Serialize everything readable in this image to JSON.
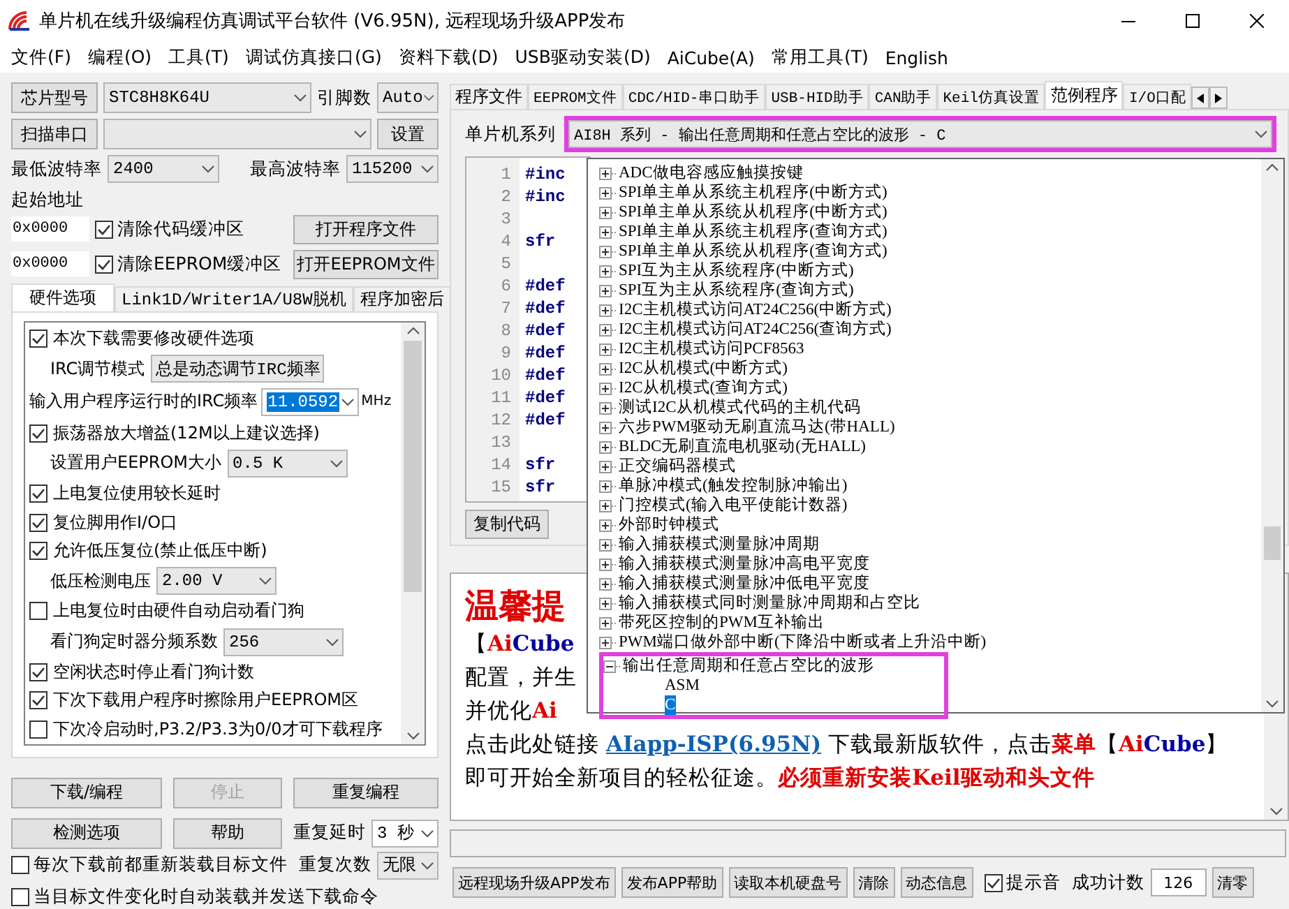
{
  "window": {
    "title": "单片机在线升级编程仿真调试平台软件 (V6.95N), 远程现场升级APP发布"
  },
  "menu": [
    "文件(F)",
    "编程(O)",
    "工具(T)",
    "调试仿真接口(G)",
    "资料下载(D)",
    "USB驱动安装(D)",
    "AiCube(A)",
    "常用工具(T)",
    "English"
  ],
  "left": {
    "chip": {
      "button": "芯片型号",
      "value": "STC8H8K64U",
      "pins_label": "引脚数",
      "pins": "Auto"
    },
    "port": {
      "button": "扫描串口",
      "settings": "设置"
    },
    "baud": {
      "min_label": "最低波特率",
      "min": "2400",
      "max_label": "最高波特率",
      "max": "115200"
    },
    "start_address_label": "起始地址",
    "buffers": [
      {
        "address": "0x0000",
        "label": "清除代码缓冲区",
        "checked": true,
        "button": "打开程序文件"
      },
      {
        "address": "0x0000",
        "label": "清除EEPROM缓冲区",
        "checked": true,
        "button": "打开EEPROM文件"
      }
    ],
    "tabs": [
      {
        "label": "硬件选项",
        "selected": true
      },
      {
        "label": "Link1D/Writer1A/U8W脱机",
        "selected": false
      },
      {
        "label": "程序加密后",
        "selected": false
      }
    ],
    "options": [
      {
        "kind": "check",
        "label": "本次下载需要修改硬件选项",
        "checked": true
      },
      {
        "kind": "select",
        "label": "IRC调节模式",
        "value": "总是动态调节IRC频率"
      },
      {
        "kind": "freq",
        "label": "输入用户程序运行时的IRC频率",
        "value": "11.0592",
        "unit": "MHz"
      },
      {
        "kind": "check",
        "label": "振荡器放大增益(12M以上建议选择)",
        "checked": true
      },
      {
        "kind": "select",
        "label": "设置用户EEPROM大小",
        "value": "0.5 K"
      },
      {
        "kind": "check",
        "label": "上电复位使用较长延时",
        "checked": true
      },
      {
        "kind": "check",
        "label": "复位脚用作I/O口",
        "checked": true
      },
      {
        "kind": "check",
        "label": "允许低压复位(禁止低压中断)",
        "checked": true
      },
      {
        "kind": "select",
        "label": "低压检测电压",
        "value": "2.00 V"
      },
      {
        "kind": "check",
        "label": "上电复位时由硬件自动启动看门狗",
        "checked": false
      },
      {
        "kind": "select",
        "label": "看门狗定时器分频系数",
        "value": "256"
      },
      {
        "kind": "check",
        "label": "空闲状态时停止看门狗计数",
        "checked": true
      },
      {
        "kind": "check",
        "label": "下次下载用户程序时擦除用户EEPROM区",
        "checked": true
      },
      {
        "kind": "check",
        "label": "下次冷启动时,P3.2/P3.3为0/0才可下载程序",
        "checked": false
      }
    ],
    "actions": [
      {
        "label": "下载/编程",
        "disabled": false
      },
      {
        "label": "停止",
        "disabled": true
      },
      {
        "label": "重复编程",
        "disabled": false
      },
      {
        "label": "检测选项",
        "disabled": false
      },
      {
        "label": "帮助",
        "disabled": false
      }
    ],
    "repeat": [
      {
        "label": "重复延时",
        "value": "3 秒"
      },
      {
        "label": "重复次数",
        "value": "无限"
      }
    ],
    "auto_options": [
      {
        "label": "每次下载前都重新装载目标文件",
        "checked": false
      },
      {
        "label": "当目标文件变化时自动装载并发送下载命令",
        "checked": false
      }
    ]
  },
  "right": {
    "tabs": [
      {
        "label": "程序文件",
        "selected": false
      },
      {
        "label": "EEPROM文件",
        "selected": false
      },
      {
        "label": "CDC/HID-串口助手",
        "selected": false
      },
      {
        "label": "USB-HID助手",
        "selected": false
      },
      {
        "label": "CAN助手",
        "selected": false
      },
      {
        "label": "Keil仿真设置",
        "selected": false
      },
      {
        "label": "范例程序",
        "selected": true
      },
      {
        "label": "I/O口配",
        "selected": false
      }
    ],
    "series": {
      "label": "单片机系列",
      "value": "AI8H 系列 - 输出任意周期和任意占空比的波形 - C",
      "highlighted": true
    },
    "code": [
      {
        "number": "1",
        "text": "#inc"
      },
      {
        "number": "2",
        "text": "#inc"
      },
      {
        "number": "3"
      },
      {
        "number": "4",
        "text": "sfr"
      },
      {
        "number": "5"
      },
      {
        "number": "6",
        "text": "#def"
      },
      {
        "number": "7",
        "text": "#def"
      },
      {
        "number": "8",
        "text": "#def"
      },
      {
        "number": "9",
        "text": "#def"
      },
      {
        "number": "10",
        "text": "#def"
      },
      {
        "number": "11",
        "text": "#def"
      },
      {
        "number": "12",
        "text": "#def"
      },
      {
        "number": "13"
      },
      {
        "number": "14",
        "text": "sfr"
      },
      {
        "number": "15",
        "text": "sfr"
      }
    ],
    "copy_button": "复制代码",
    "notice": [
      [
        {
          "kind": "title",
          "text": "温馨提"
        }
      ],
      [
        {
          "kind": "plain",
          "text": "【"
        },
        {
          "kind": "red",
          "text": "Ai"
        },
        {
          "kind": "blue",
          "text": "Cube"
        }
      ],
      [
        {
          "kind": "plain",
          "text": "配置，并生"
        }
      ],
      [
        {
          "kind": "plain",
          "text": "并优化"
        },
        {
          "kind": "red",
          "text": "Ai"
        }
      ],
      [
        {
          "kind": "plain",
          "text": "点击此处链接 "
        },
        {
          "kind": "link",
          "text": "AIapp-ISP(6.95N)"
        },
        {
          "kind": "plain",
          "text": " 下载最新版软件，点击"
        },
        {
          "kind": "red",
          "text": "菜单"
        },
        {
          "kind": "plain",
          "text": "【"
        },
        {
          "kind": "red",
          "text": "Ai"
        },
        {
          "kind": "blue",
          "text": "Cube"
        },
        {
          "kind": "plain",
          "text": "】"
        }
      ],
      [
        {
          "kind": "plain",
          "text": "即可开始全新项目的轻松征途。"
        },
        {
          "kind": "alert",
          "text": "必须重新安装Keil驱动和头文件"
        }
      ]
    ],
    "bottom": {
      "buttons": [
        "远程现场升级APP发布",
        "发布APP帮助",
        "读取本机硬盘号",
        "清除",
        "动态信息"
      ],
      "beep": {
        "label": "提示音",
        "checked": true
      },
      "count_label": "成功计数",
      "count": "126",
      "clear": "清零"
    }
  },
  "dropdown": {
    "items": [
      {
        "label": "ADC做电容感应触摸按键",
        "expanded": false
      },
      {
        "label": "SPI单主单从系统主机程序(中断方式)",
        "expanded": false
      },
      {
        "label": "SPI单主单从系统从机程序(中断方式)",
        "expanded": false
      },
      {
        "label": "SPI单主单从系统主机程序(查询方式)",
        "expanded": false
      },
      {
        "label": "SPI单主单从系统从机程序(查询方式)",
        "expanded": false
      },
      {
        "label": "SPI互为主从系统程序(中断方式)",
        "expanded": false
      },
      {
        "label": "SPI互为主从系统程序(查询方式)",
        "expanded": false
      },
      {
        "label": "I2C主机模式访问AT24C256(中断方式)",
        "expanded": false
      },
      {
        "label": "I2C主机模式访问AT24C256(查询方式)",
        "expanded": false
      },
      {
        "label": "I2C主机模式访问PCF8563",
        "expanded": false
      },
      {
        "label": "I2C从机模式(中断方式)",
        "expanded": false
      },
      {
        "label": "I2C从机模式(查询方式)",
        "expanded": false
      },
      {
        "label": "测试I2C从机模式代码的主机代码",
        "expanded": false
      },
      {
        "label": "六步PWM驱动无刷直流马达(带HALL)",
        "expanded": false
      },
      {
        "label": "BLDC无刷直流电机驱动(无HALL)",
        "expanded": false
      },
      {
        "label": "正交编码器模式",
        "expanded": false
      },
      {
        "label": "单脉冲模式(触发控制脉冲输出)",
        "expanded": false
      },
      {
        "label": "门控模式(输入电平使能计数器)",
        "expanded": false
      },
      {
        "label": "外部时钟模式",
        "expanded": false
      },
      {
        "label": "输入捕获模式测量脉冲周期",
        "expanded": false
      },
      {
        "label": "输入捕获模式测量脉冲高电平宽度",
        "expanded": false
      },
      {
        "label": "输入捕获模式测量脉冲低电平宽度",
        "expanded": false
      },
      {
        "label": "输入捕获模式同时测量脉冲周期和占空比",
        "expanded": false
      },
      {
        "label": "带死区控制的PWM互补输出",
        "expanded": false
      },
      {
        "label": "PWM端口做外部中断(下降沿中断或者上升沿中断)",
        "expanded": false
      },
      {
        "label": "输出任意周期和任意占空比的波形",
        "expanded": true,
        "highlighted": true,
        "children": [
          {
            "label": "ASM",
            "selected": false
          },
          {
            "label": "C",
            "selected": true
          }
        ]
      }
    ]
  }
}
